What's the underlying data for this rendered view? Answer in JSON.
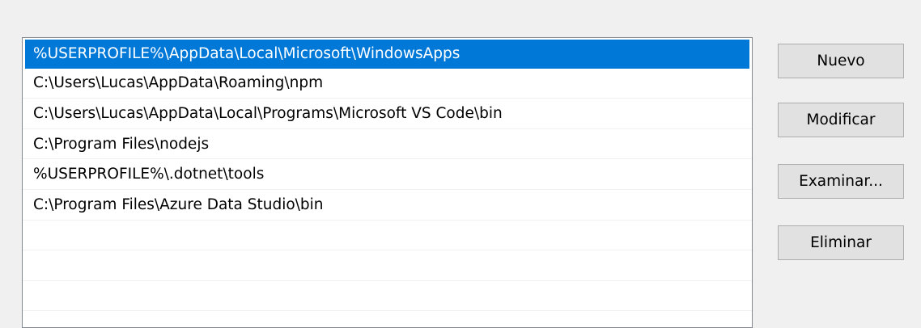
{
  "path_list": {
    "selected_index": 0,
    "entries": [
      "%USERPROFILE%\\AppData\\Local\\Microsoft\\WindowsApps",
      "C:\\Users\\Lucas\\AppData\\Roaming\\npm",
      "C:\\Users\\Lucas\\AppData\\Local\\Programs\\Microsoft VS Code\\bin",
      "C:\\Program Files\\nodejs",
      "%USERPROFILE%\\.dotnet\\tools",
      "C:\\Program Files\\Azure Data Studio\\bin",
      "",
      "",
      ""
    ]
  },
  "buttons": {
    "new_label": "Nuevo",
    "edit_label": "Modificar",
    "browse_label": "Examinar...",
    "delete_label": "Eliminar"
  },
  "colors": {
    "selection": "#0078d7",
    "button_face": "#e1e1e1",
    "background": "#f0f0f0"
  }
}
